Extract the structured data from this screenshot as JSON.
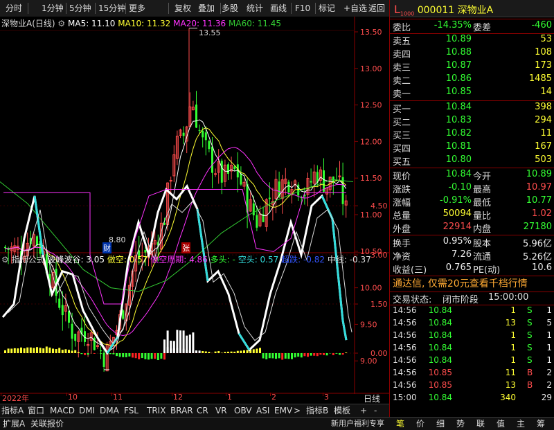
{
  "toolbar": {
    "items": [
      "分时",
      "1分钟",
      "5分钟",
      "15分钟",
      "更多",
      "复权",
      "叠加",
      "多股",
      "统计",
      "画线",
      "F10",
      "标记",
      "+自选",
      "返回"
    ]
  },
  "kline_title": {
    "name": "深物业A(日线)",
    "ma5": "MA5: 11.10",
    "ma10": "MA10: 11.32",
    "ma20": "MA20: 11.36",
    "ma60": "MA60: 11.45",
    "high_label": "13.55",
    "low_label": "8.80",
    "marker_cai": "财",
    "marker_zhang": "张"
  },
  "price_axis": [
    "13.50",
    "13.00",
    "12.50",
    "12.00",
    "11.50",
    "11.00",
    "10.50",
    "10.00",
    "9.50",
    "9.00"
  ],
  "indicator_title": {
    "prefix": "指标公式",
    "bofeng": "波峰波谷: 3.05",
    "zuokong": "做空: 0.57",
    "zkzq": "做空周期: 4.86",
    "duotou": "多头: -",
    "kongtou": "空头: 0.57",
    "chaodie": "超跌: -0.82",
    "zhongxian": "中线: -0.37"
  },
  "ind_axis": [
    "4.50",
    "3.00",
    "1.50",
    "0.00"
  ],
  "date_axis": [
    "2022年",
    "10",
    "11",
    "12",
    "1",
    "2",
    "3"
  ],
  "date_axis_right": "日线",
  "tabs": [
    "指标A",
    "窗口",
    "MACD",
    "DMI",
    "DMA",
    "FSL",
    "TRIX",
    "BRAR",
    "CR",
    "VR",
    "OBV",
    "ASI",
    "EMV",
    ">",
    "指标B",
    "模",
    "板",
    "+",
    "-"
  ],
  "bottom": {
    "left": [
      "扩展A",
      "关联报价"
    ],
    "right_promo": "新用户福利专享",
    "right_tabs": [
      "笔",
      "价",
      "细",
      "势",
      "联",
      "值",
      "主",
      "筹"
    ]
  },
  "quote": {
    "code_prefix": "L",
    "code_sub": "1000",
    "code": "000011",
    "name": "深物业A",
    "weibi_label": "委比",
    "weibi": "-14.35%",
    "weicha_label": "委差",
    "weicha": "-460",
    "sells": [
      {
        "label": "卖五",
        "price": "10.89",
        "vol": "53"
      },
      {
        "label": "卖四",
        "price": "10.88",
        "vol": "108"
      },
      {
        "label": "卖三",
        "price": "10.87",
        "vol": "173"
      },
      {
        "label": "卖二",
        "price": "10.86",
        "vol": "1485"
      },
      {
        "label": "卖一",
        "price": "10.85",
        "vol": "14"
      }
    ],
    "buys": [
      {
        "label": "买一",
        "price": "10.84",
        "vol": "398"
      },
      {
        "label": "买二",
        "price": "10.83",
        "vol": "294"
      },
      {
        "label": "买三",
        "price": "10.82",
        "vol": "11"
      },
      {
        "label": "买四",
        "price": "10.81",
        "vol": "167"
      },
      {
        "label": "买五",
        "price": "10.80",
        "vol": "503"
      }
    ],
    "stats": [
      {
        "l1": "现价",
        "v1": "10.84",
        "c1": "green",
        "l2": "今开",
        "v2": "10.89",
        "c2": "green"
      },
      {
        "l1": "涨跌",
        "v1": "-0.10",
        "c1": "green",
        "l2": "最高",
        "v2": "10.97",
        "c2": "red"
      },
      {
        "l1": "涨幅",
        "v1": "-0.91%",
        "c1": "green",
        "l2": "最低",
        "v2": "10.77",
        "c2": "green"
      },
      {
        "l1": "总量",
        "v1": "50094",
        "c1": "yellow",
        "l2": "量比",
        "v2": "1.02",
        "c2": "red"
      },
      {
        "l1": "外盘",
        "v1": "22914",
        "c1": "red",
        "l2": "内盘",
        "v2": "27180",
        "c2": "green"
      }
    ],
    "stats2": [
      {
        "l1": "换手",
        "v1": "0.95%",
        "l2": "股本",
        "v2": "5.96亿"
      },
      {
        "l1": "净资",
        "v1": "7.26",
        "l2": "流通",
        "v2": "5.26亿"
      },
      {
        "l1": "收益(三)",
        "v1": "0.765",
        "l2": "PE(动)",
        "v2": "10.6"
      }
    ],
    "promo": "通达信, 仅需20元查看千档行情",
    "trade_state_label": "交易状态:",
    "trade_state": "闭市阶段",
    "trade_time": "15:00:00",
    "ticks": [
      {
        "t": "14:56",
        "p": "10.84",
        "v": "1",
        "s": "S",
        "n": "1"
      },
      {
        "t": "14:56",
        "p": "10.84",
        "v": "13",
        "s": "S",
        "n": "5"
      },
      {
        "t": "14:56",
        "p": "10.84",
        "v": "1",
        "s": "S",
        "n": "1"
      },
      {
        "t": "14:56",
        "p": "10.84",
        "v": "1",
        "s": "S",
        "n": "1"
      },
      {
        "t": "14:56",
        "p": "10.84",
        "v": "1",
        "s": "S",
        "n": "1"
      },
      {
        "t": "14:56",
        "p": "10.85",
        "v": "11",
        "s": "B",
        "n": "2"
      },
      {
        "t": "14:56",
        "p": "10.85",
        "v": "13",
        "s": "B",
        "n": "2"
      },
      {
        "t": "15:00",
        "p": "10.84",
        "v": "340",
        "s": "",
        "n": "29"
      }
    ]
  },
  "colors": {
    "up": "#ff4d4d",
    "down": "#33ff33",
    "ma5": "#ffffff",
    "ma10": "#ffff33",
    "ma20": "#ff33ff",
    "ma60": "#33cc33",
    "frame": "#8b0000",
    "cyan": "#33dddd"
  }
}
